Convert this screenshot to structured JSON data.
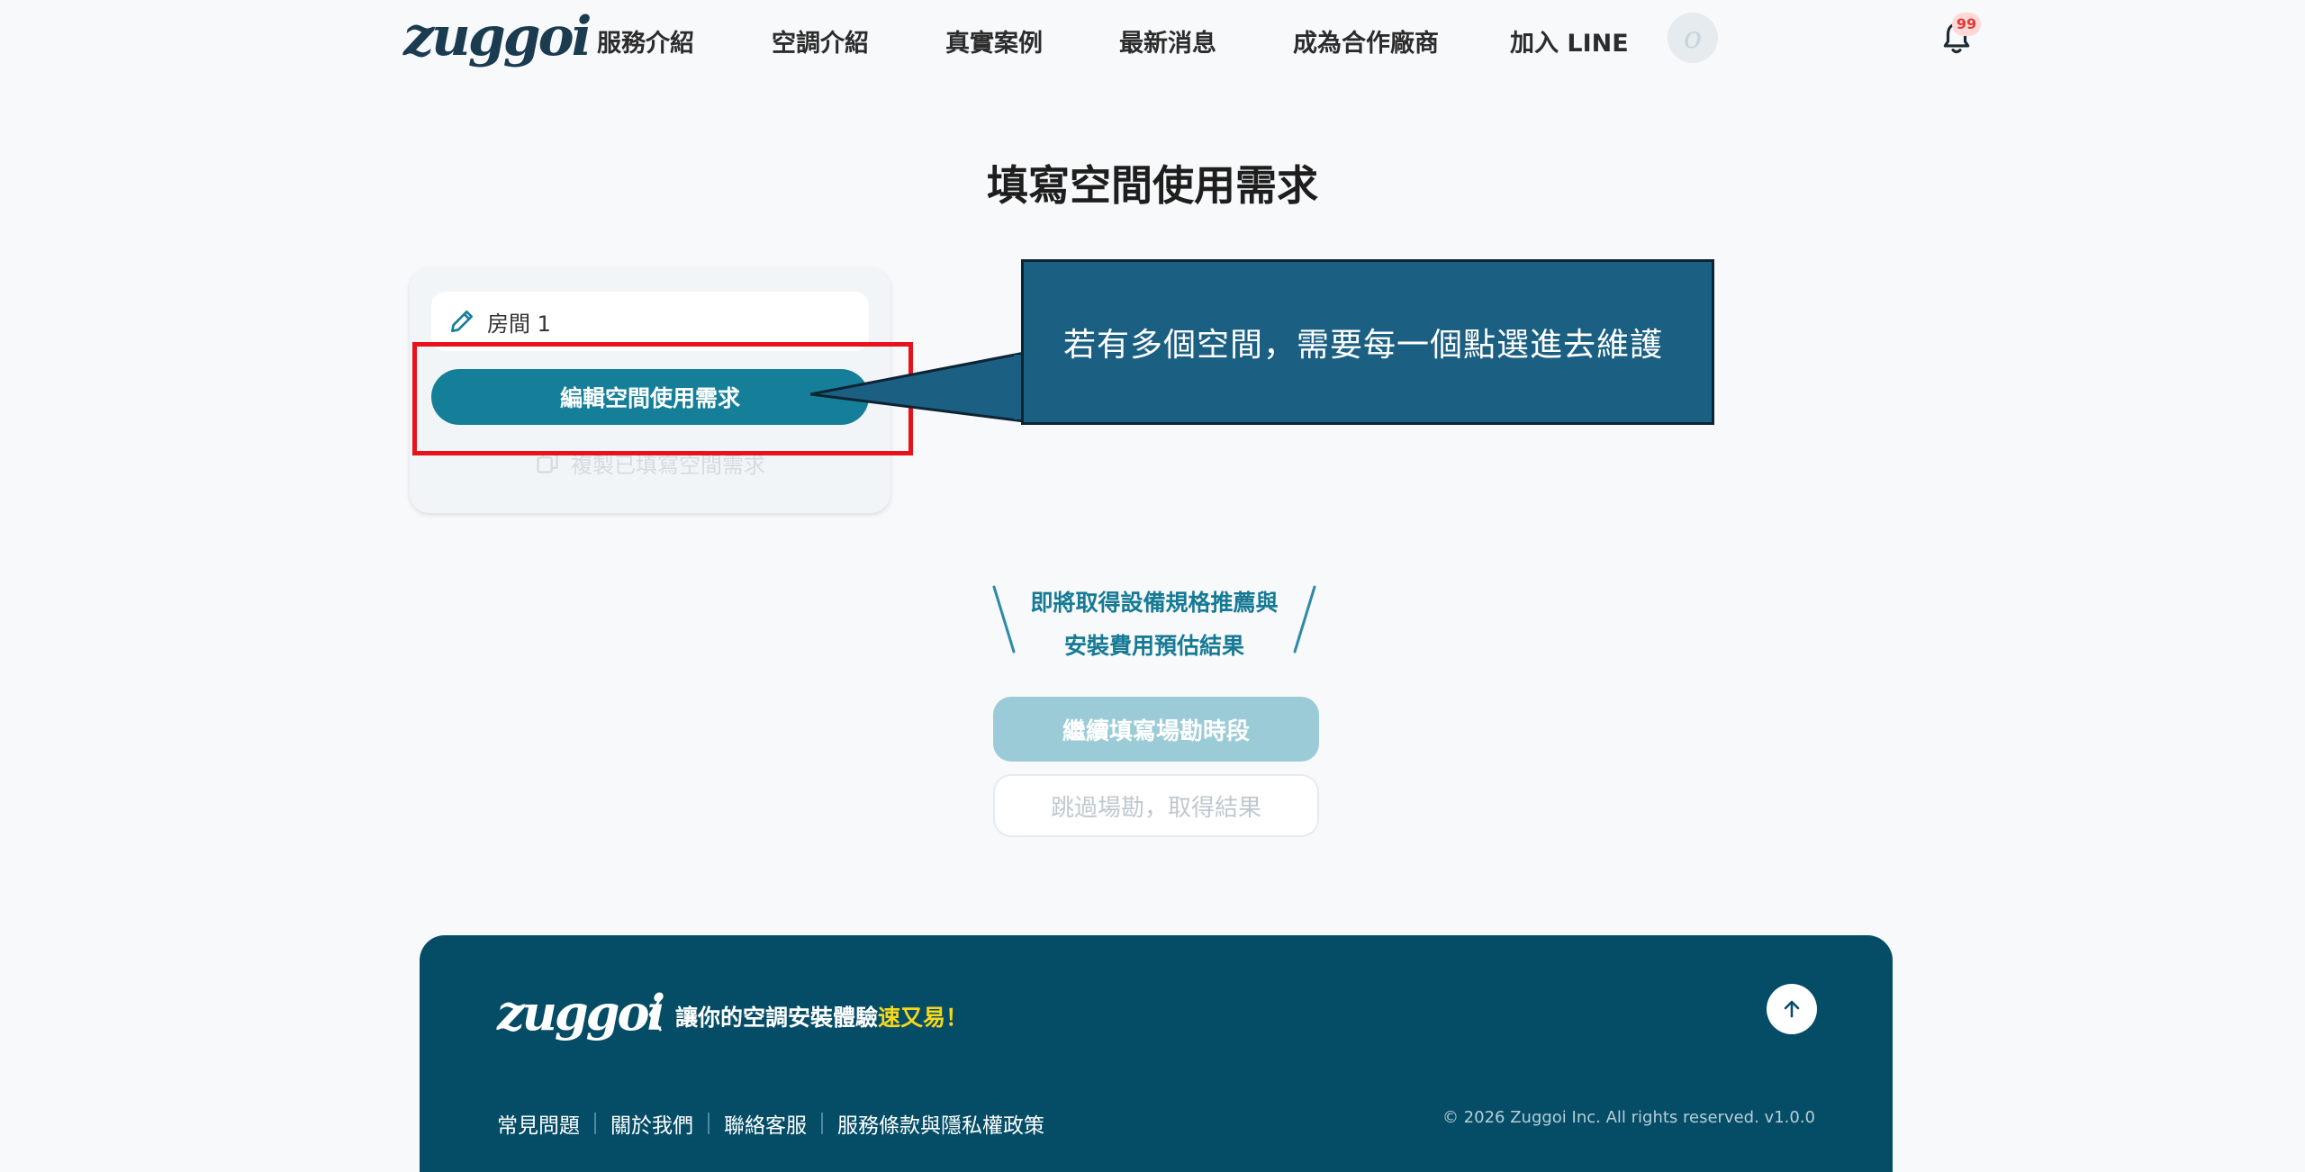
{
  "header": {
    "logo": "zuggoi",
    "nav": [
      {
        "label": "服務介紹"
      },
      {
        "label": "空調介紹"
      },
      {
        "label": "真實案例"
      },
      {
        "label": "最新消息"
      },
      {
        "label": "成為合作廠商"
      },
      {
        "label": "加入 LINE"
      }
    ],
    "avatar_glyph": "o",
    "notification_count": "99"
  },
  "page": {
    "title": "填寫空間使用需求"
  },
  "space_card": {
    "room_name": "房間 1",
    "edit_button": "編輯空間使用需求",
    "copy_label": "複製已填寫空間需求"
  },
  "callout": {
    "text": "若有多個空間，需要每一個點選進去維護"
  },
  "promo": {
    "line1": "即將取得設備規格推薦與",
    "line2": "安裝費用預估結果"
  },
  "actions": {
    "continue_button": "繼續填寫場勘時段",
    "skip_button": "跳過場勘，取得結果"
  },
  "footer": {
    "logo": "zuggoi",
    "slogan_prefix": "讓你的空調安裝體驗",
    "slogan_highlight": "速又易！",
    "links": [
      {
        "label": "常見問題"
      },
      {
        "label": "關於我們"
      },
      {
        "label": "聯絡客服"
      },
      {
        "label": "服務條款與隱私權政策"
      }
    ],
    "copyright": "© 2026 Zuggoi Inc. All rights reserved. v1.0.0"
  },
  "colors": {
    "primary": "#157f99",
    "footer_bg": "#054d66",
    "callout_bg": "#1b5f82",
    "highlight_red": "#e8121b",
    "slogan_yellow": "#f5d71d"
  }
}
